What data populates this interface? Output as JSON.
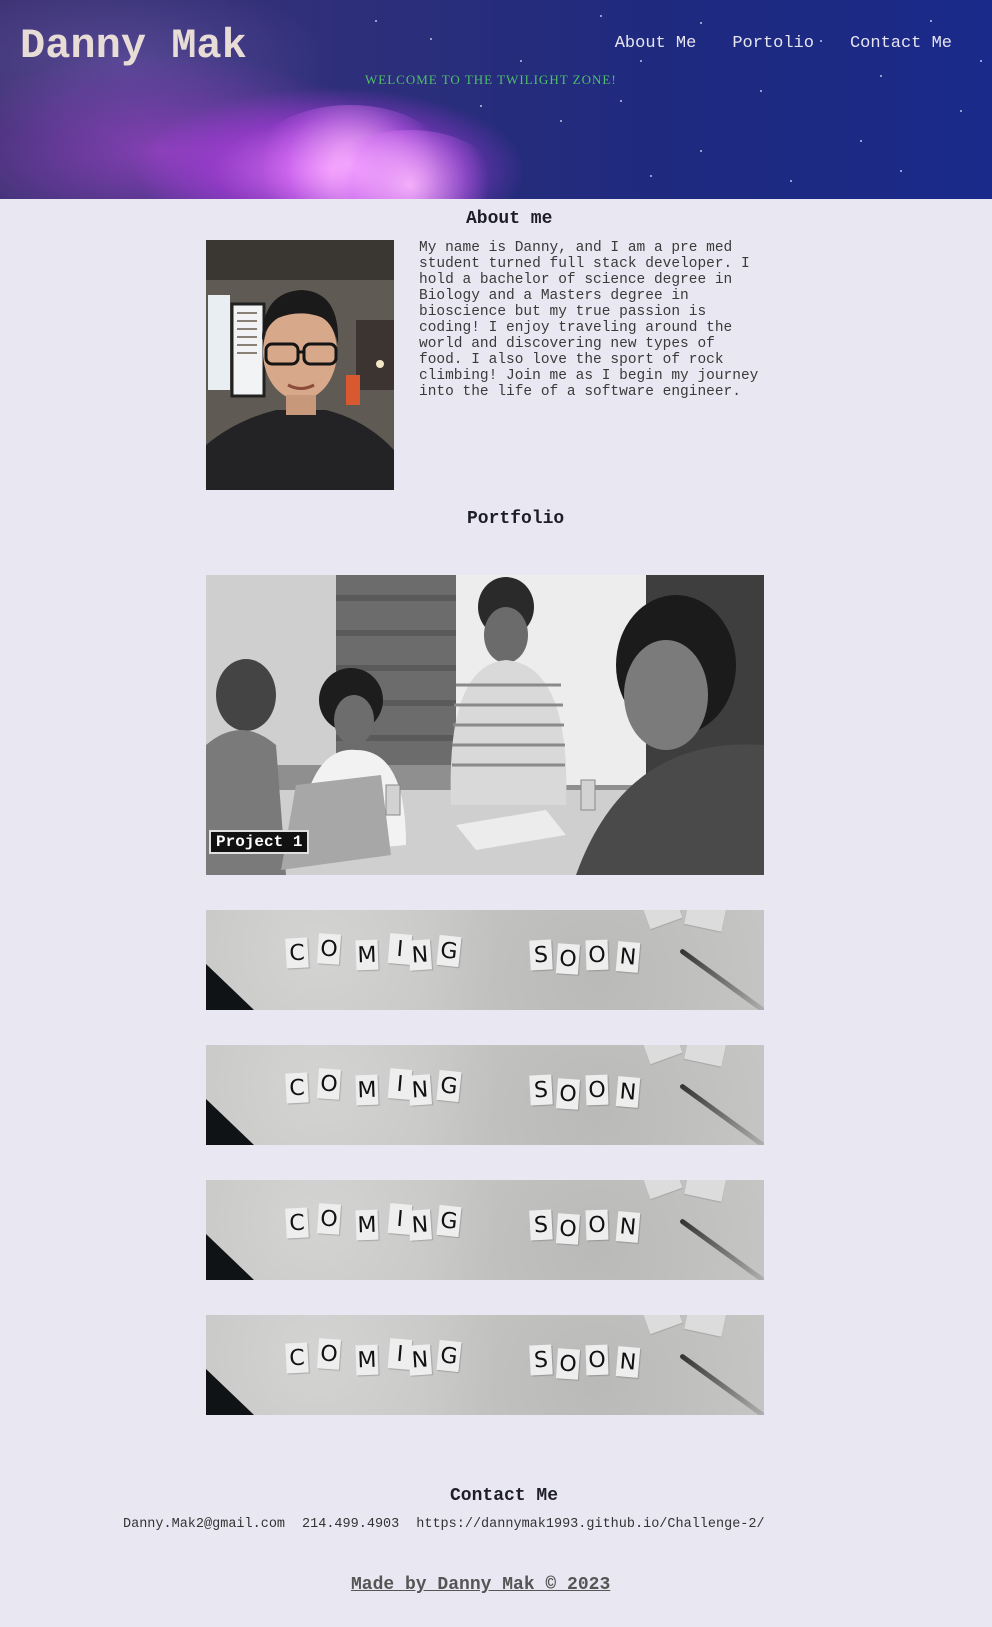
{
  "header": {
    "title": "Danny Mak",
    "tagline": "WELCOME TO THE TWILIGHT ZONE!",
    "nav": [
      {
        "label": "About Me"
      },
      {
        "label": "Portolio"
      },
      {
        "label": "Contact Me"
      }
    ]
  },
  "about": {
    "title": "About me",
    "text": "My name is Danny, and I am a pre med student turned full stack developer. I hold a bachelor of science degree in Biology and a Masters degree in bioscience but my true passion is coding! I enjoy traveling around the world and discovering new types of food. I also love the sport of rock climbing! Join me as I begin my journey into the life of a software engineer."
  },
  "portfolio": {
    "title": "Portfolio",
    "project_label": "Project 1",
    "coming_soon_letters": [
      "C",
      "O",
      "M",
      "I",
      "N",
      "G",
      "S",
      "O",
      "O",
      "N"
    ]
  },
  "contact": {
    "title": "Contact Me",
    "email": "Danny.Mak2@gmail.com",
    "phone": "214.499.4903",
    "url": "https://dannymak1993.github.io/Challenge-2/"
  },
  "footer": {
    "text": "Made by Danny Mak © 2023"
  },
  "colors": {
    "page_background": "#e9e8f2",
    "tagline": "#4fbf6a",
    "header_sky": "#1f2a7e",
    "header_glow": "#e278ff"
  }
}
